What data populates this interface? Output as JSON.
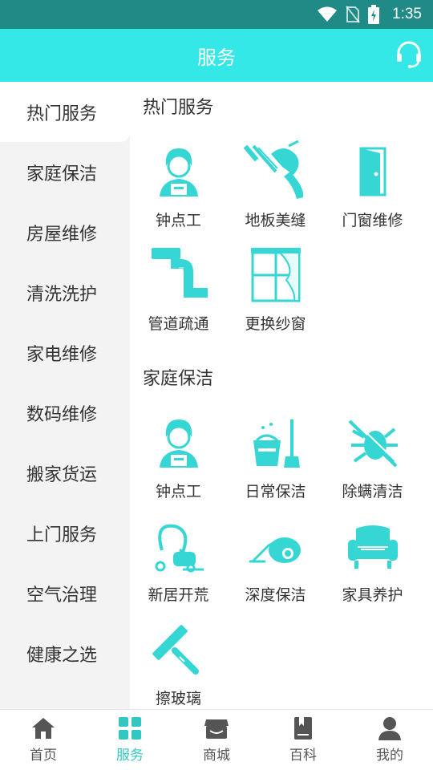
{
  "status_bar": {
    "time": "1:35",
    "icons": [
      "wifi-icon",
      "no-sim-icon",
      "battery-icon"
    ]
  },
  "app_bar": {
    "title": "服务",
    "right_icon": "headset-icon"
  },
  "colors": {
    "accent": "#33e8e6",
    "status_bar": "#1f8a86",
    "icon": "#35d6d4",
    "active_tab": "#33c7c4"
  },
  "sidebar": {
    "items": [
      {
        "label": "热门服务",
        "active": true
      },
      {
        "label": "家庭保洁"
      },
      {
        "label": "房屋维修"
      },
      {
        "label": "清洗洗护"
      },
      {
        "label": "家电维修"
      },
      {
        "label": "数码维修"
      },
      {
        "label": "搬家货运"
      },
      {
        "label": "上门服务"
      },
      {
        "label": "空气治理"
      },
      {
        "label": "健康之选"
      }
    ]
  },
  "sections": [
    {
      "title": "热门服务",
      "items": [
        {
          "label": "钟点工",
          "icon": "housekeeper-icon"
        },
        {
          "label": "地板美缝",
          "icon": "grout-gun-icon"
        },
        {
          "label": "门窗维修",
          "icon": "door-icon"
        },
        {
          "label": "管道疏通",
          "icon": "pipe-icon"
        },
        {
          "label": "更换纱窗",
          "icon": "window-curtain-icon"
        }
      ]
    },
    {
      "title": "家庭保洁",
      "items": [
        {
          "label": "钟点工",
          "icon": "housekeeper-icon"
        },
        {
          "label": "日常保洁",
          "icon": "bucket-mop-icon"
        },
        {
          "label": "除螨清洁",
          "icon": "no-mite-icon"
        },
        {
          "label": "新居开荒",
          "icon": "vacuum-icon"
        },
        {
          "label": "深度保洁",
          "icon": "canister-vacuum-icon"
        },
        {
          "label": "家具养护",
          "icon": "sofa-icon"
        },
        {
          "label": "擦玻璃",
          "icon": "squeegee-icon"
        }
      ]
    }
  ],
  "tab_bar": {
    "tabs": [
      {
        "label": "首页",
        "icon": "home-icon"
      },
      {
        "label": "服务",
        "icon": "grid-icon",
        "active": true
      },
      {
        "label": "商城",
        "icon": "store-icon"
      },
      {
        "label": "百科",
        "icon": "book-icon"
      },
      {
        "label": "我的",
        "icon": "user-icon"
      }
    ]
  }
}
